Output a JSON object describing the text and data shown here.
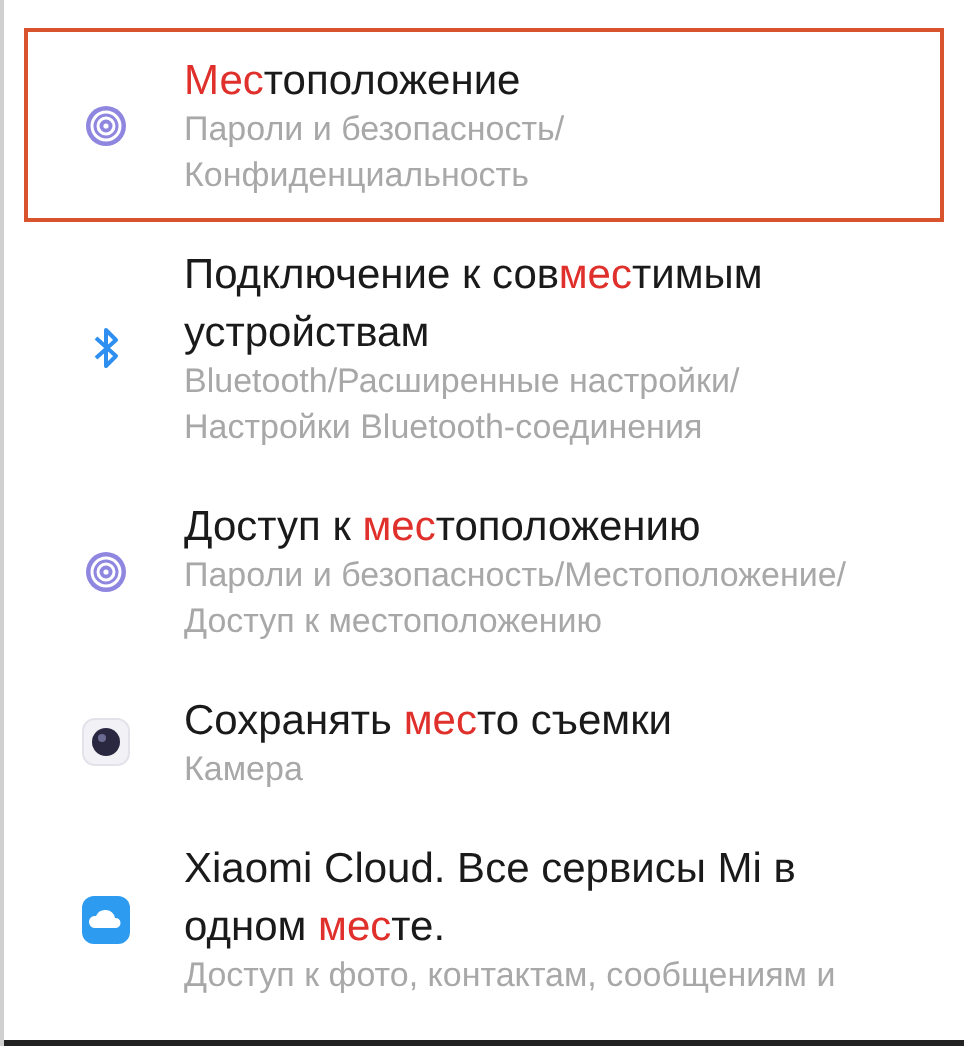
{
  "results": [
    {
      "kind": "fingerprint",
      "selected": true,
      "title": [
        {
          "text": "Мес",
          "match": true
        },
        {
          "text": "тоположение",
          "match": false
        }
      ],
      "subtitle": "Пароли и безопасность/\nКонфиденциальность"
    },
    {
      "kind": "bluetooth",
      "selected": false,
      "title": [
        {
          "text": "Подключение к сов",
          "match": false
        },
        {
          "text": "мес",
          "match": true
        },
        {
          "text": "тимым\nустройствам",
          "match": false
        }
      ],
      "subtitle": "Bluetooth/Расширенные настройки/\nНастройки Bluetooth-соединения"
    },
    {
      "kind": "fingerprint",
      "selected": false,
      "title": [
        {
          "text": "Доступ к ",
          "match": false
        },
        {
          "text": "мес",
          "match": true
        },
        {
          "text": "тоположению",
          "match": false
        }
      ],
      "subtitle": "Пароли и безопасность/Местоположение/\nДоступ к местоположению"
    },
    {
      "kind": "camera",
      "selected": false,
      "title": [
        {
          "text": "Сохранять ",
          "match": false
        },
        {
          "text": "мес",
          "match": true
        },
        {
          "text": "то съемки",
          "match": false
        }
      ],
      "subtitle": "Камера"
    },
    {
      "kind": "cloud",
      "selected": false,
      "title": [
        {
          "text": "Xiaomi Cloud. Все сервисы Mi в\nодном ",
          "match": false
        },
        {
          "text": "мес",
          "match": true
        },
        {
          "text": "те.",
          "match": false
        }
      ],
      "subtitle": "Доступ к фото, контактам, сообщениям и"
    }
  ]
}
